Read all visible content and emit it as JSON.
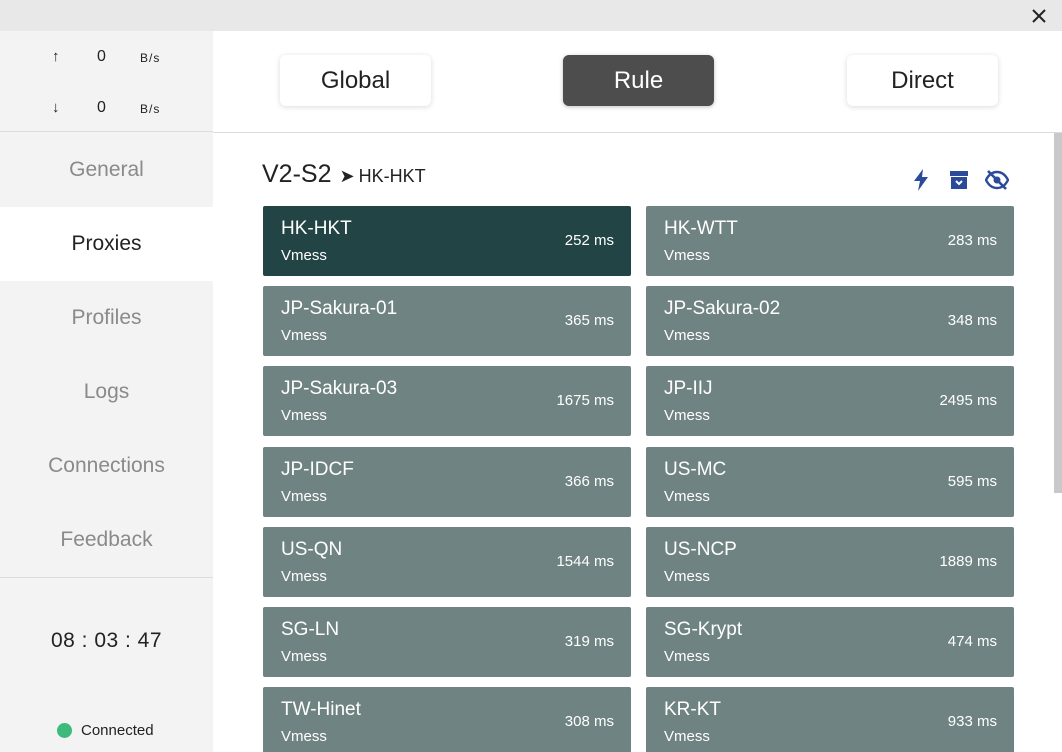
{
  "window": {
    "close_icon": "close-icon"
  },
  "traffic": {
    "up_arrow": "↑",
    "up_value": "0",
    "up_unit": "B/s",
    "down_arrow": "↓",
    "down_value": "0",
    "down_unit": "B/s"
  },
  "nav": {
    "items": [
      {
        "label": "General",
        "active": false
      },
      {
        "label": "Proxies",
        "active": true
      },
      {
        "label": "Profiles",
        "active": false
      },
      {
        "label": "Logs",
        "active": false
      },
      {
        "label": "Connections",
        "active": false
      },
      {
        "label": "Feedback",
        "active": false
      }
    ]
  },
  "clock": "08 : 03 : 47",
  "status": {
    "label": "Connected",
    "color": "#3dbb7c"
  },
  "modes": {
    "global": "Global",
    "rule": "Rule",
    "direct": "Direct",
    "selected": "rule"
  },
  "group": {
    "name": "V2-S2",
    "arrow": "➤",
    "selected_proxy": "HK-HKT",
    "actions": [
      "lightning-icon",
      "archive-icon",
      "eye-off-icon"
    ],
    "icon_color": "#2b4a9a"
  },
  "colors": {
    "card_selected": "#234444",
    "card_default": "#6f8482"
  },
  "proxies": [
    {
      "name": "HK-HKT",
      "type": "Vmess",
      "latency": "252 ms",
      "selected": true
    },
    {
      "name": "HK-WTT",
      "type": "Vmess",
      "latency": "283 ms",
      "selected": false
    },
    {
      "name": "JP-Sakura-01",
      "type": "Vmess",
      "latency": "365 ms",
      "selected": false
    },
    {
      "name": "JP-Sakura-02",
      "type": "Vmess",
      "latency": "348 ms",
      "selected": false
    },
    {
      "name": "JP-Sakura-03",
      "type": "Vmess",
      "latency": "1675 ms",
      "selected": false
    },
    {
      "name": "JP-IIJ",
      "type": "Vmess",
      "latency": "2495 ms",
      "selected": false
    },
    {
      "name": "JP-IDCF",
      "type": "Vmess",
      "latency": "366 ms",
      "selected": false
    },
    {
      "name": "US-MC",
      "type": "Vmess",
      "latency": "595 ms",
      "selected": false
    },
    {
      "name": "US-QN",
      "type": "Vmess",
      "latency": "1544 ms",
      "selected": false
    },
    {
      "name": "US-NCP",
      "type": "Vmess",
      "latency": "1889 ms",
      "selected": false
    },
    {
      "name": "SG-LN",
      "type": "Vmess",
      "latency": "319 ms",
      "selected": false
    },
    {
      "name": "SG-Krypt",
      "type": "Vmess",
      "latency": "474 ms",
      "selected": false
    },
    {
      "name": "TW-Hinet",
      "type": "Vmess",
      "latency": "308 ms",
      "selected": false
    },
    {
      "name": "KR-KT",
      "type": "Vmess",
      "latency": "933 ms",
      "selected": false
    }
  ]
}
